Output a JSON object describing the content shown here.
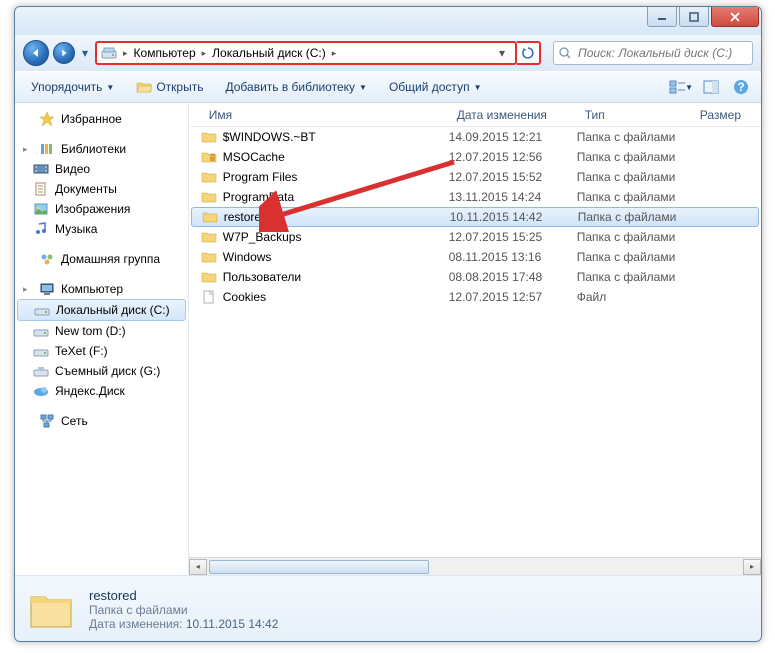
{
  "breadcrumb": {
    "seg1": "Компьютер",
    "seg2": "Локальный диск (C:)"
  },
  "search": {
    "placeholder": "Поиск: Локальный диск (C:)"
  },
  "toolbar": {
    "organize": "Упорядочить",
    "open": "Открыть",
    "add_to_lib": "Добавить в библиотеку",
    "share": "Общий доступ"
  },
  "nav": {
    "favorites": "Избранное",
    "libraries": "Библиотеки",
    "video": "Видео",
    "documents": "Документы",
    "pictures": "Изображения",
    "music": "Музыка",
    "homegroup": "Домашняя группа",
    "computer": "Компьютер",
    "local_c": "Локальный диск (C:)",
    "new_tom": "New tom (D:)",
    "texet": "TeXet (F:)",
    "removable": "Съемный диск (G:)",
    "yandex": "Яндекс.Диск",
    "network": "Сеть"
  },
  "columns": {
    "name": "Имя",
    "date": "Дата изменения",
    "type": "Тип",
    "size": "Размер"
  },
  "rows": [
    {
      "name": "$WINDOWS.~BT",
      "date": "14.09.2015 12:21",
      "type": "Папка с файлами",
      "icon": "folder"
    },
    {
      "name": "MSOCache",
      "date": "12.07.2015 12:56",
      "type": "Папка с файлами",
      "icon": "folder-lock"
    },
    {
      "name": "Program Files",
      "date": "12.07.2015 15:52",
      "type": "Папка с файлами",
      "icon": "folder"
    },
    {
      "name": "ProgramData",
      "date": "13.11.2015 14:24",
      "type": "Папка с файлами",
      "icon": "folder"
    },
    {
      "name": "restored",
      "date": "10.11.2015 14:42",
      "type": "Папка с файлами",
      "icon": "folder",
      "selected": true
    },
    {
      "name": "W7P_Backups",
      "date": "12.07.2015 15:25",
      "type": "Папка с файлами",
      "icon": "folder"
    },
    {
      "name": "Windows",
      "date": "08.11.2015 13:16",
      "type": "Папка с файлами",
      "icon": "folder"
    },
    {
      "name": "Пользователи",
      "date": "08.08.2015 17:48",
      "type": "Папка с файлами",
      "icon": "folder"
    },
    {
      "name": "Cookies",
      "date": "12.07.2015 12:57",
      "type": "Файл",
      "icon": "file"
    }
  ],
  "details": {
    "name": "restored",
    "type": "Папка с файлами",
    "date_label": "Дата изменения:",
    "date_value": "10.11.2015 14:42"
  }
}
